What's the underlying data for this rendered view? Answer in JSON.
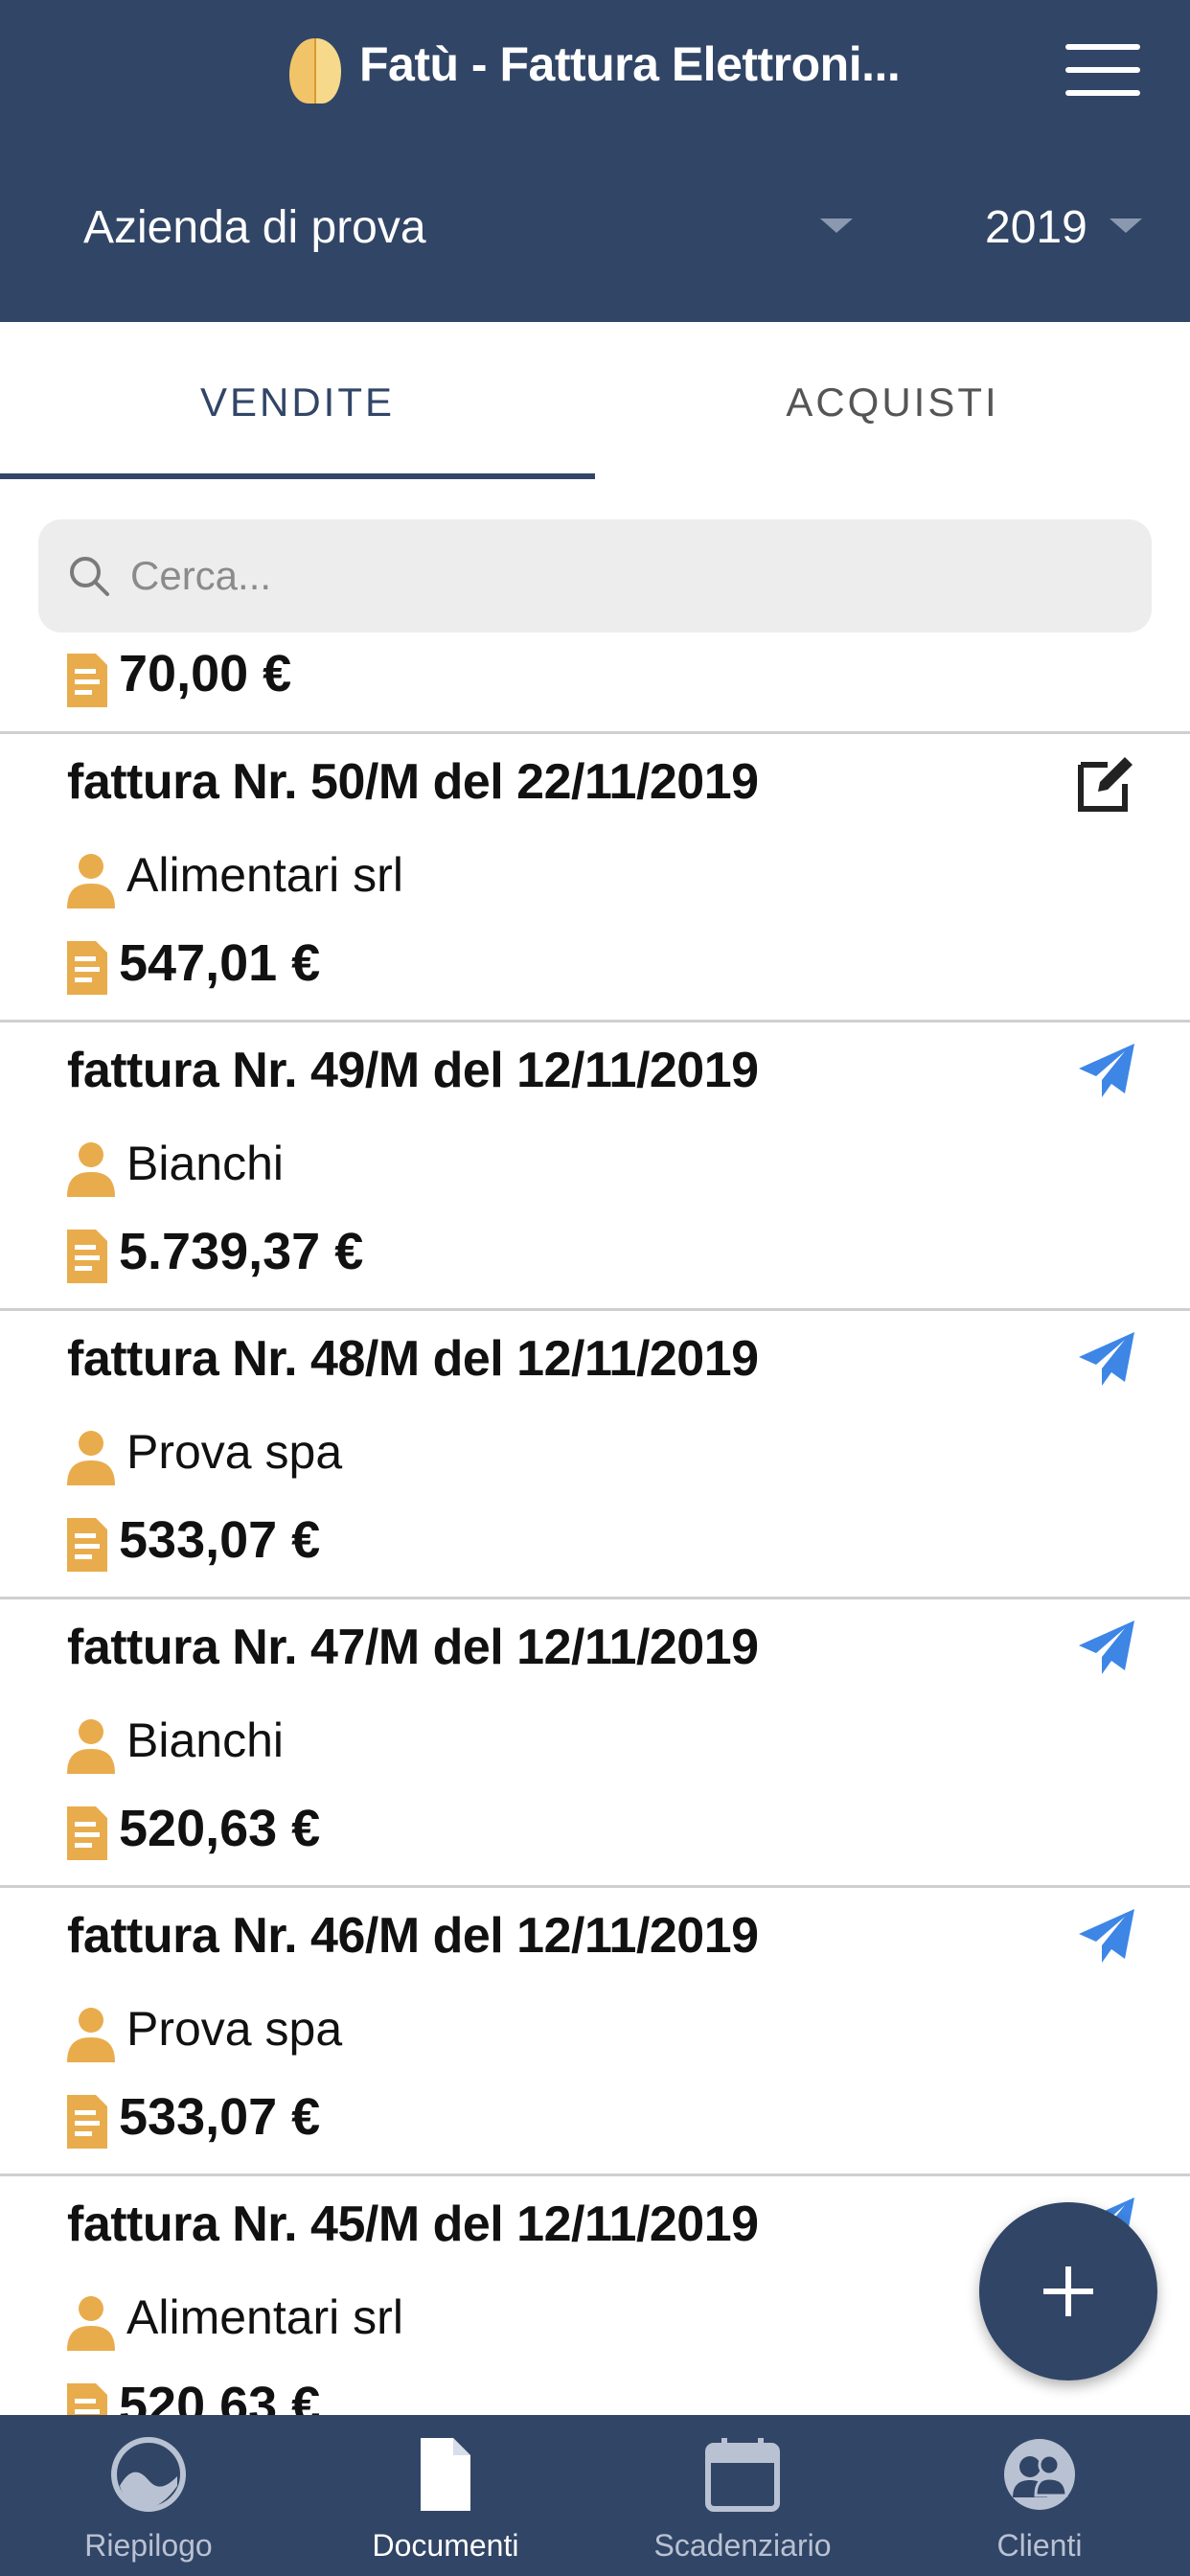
{
  "header": {
    "title": "Fatù - Fattura Elettroni...",
    "company": "Azienda di prova",
    "year": "2019"
  },
  "tabs": [
    {
      "label": "VENDITE",
      "active": true
    },
    {
      "label": "ACQUISTI",
      "active": false
    }
  ],
  "search": {
    "placeholder": "Cerca..."
  },
  "partial_row": {
    "amount": "70,00 €"
  },
  "invoices": [
    {
      "title": "fattura Nr. 50/M del 22/11/2019",
      "customer": "Alimentari srl",
      "amount": "547,01 €",
      "status": "edit-icon"
    },
    {
      "title": "fattura Nr. 49/M del 12/11/2019",
      "customer": "Bianchi",
      "amount": "5.739,37 €",
      "status": "send-icon"
    },
    {
      "title": "fattura Nr. 48/M del 12/11/2019",
      "customer": "Prova spa",
      "amount": "533,07 €",
      "status": "send-icon"
    },
    {
      "title": "fattura Nr. 47/M del 12/11/2019",
      "customer": "Bianchi",
      "amount": "520,63 €",
      "status": "send-icon"
    },
    {
      "title": "fattura Nr. 46/M del 12/11/2019",
      "customer": "Prova spa",
      "amount": "533,07 €",
      "status": "send-icon"
    },
    {
      "title": "fattura Nr. 45/M del 12/11/2019",
      "customer": "Alimentari srl",
      "amount": "520,63 €",
      "status": "send-icon"
    }
  ],
  "fab": {
    "icon": "plus-icon"
  },
  "bottom_nav": [
    {
      "label": "Riepilogo",
      "icon": "gauge-icon",
      "active": false
    },
    {
      "label": "Documenti",
      "icon": "document-icon",
      "active": true
    },
    {
      "label": "Scadenziario",
      "icon": "calendar-icon",
      "active": false
    },
    {
      "label": "Clienti",
      "icon": "clients-icon",
      "active": false
    }
  ],
  "colors": {
    "primary": "#314566",
    "accent_icon": "#e9ac4c",
    "send_icon": "#3d86e6",
    "nav_inactive": "#b9c2d3"
  }
}
